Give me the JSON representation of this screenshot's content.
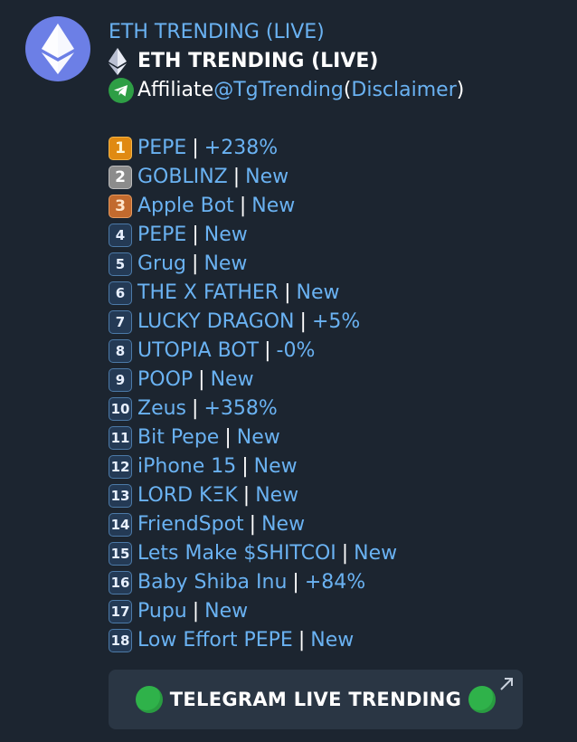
{
  "channel_name": "ETH TRENDING (LIVE)",
  "message": {
    "title": "ETH TRENDING (LIVE)",
    "affiliate": {
      "prefix": "Affiliate ",
      "handle": "@TgTrending",
      "open_paren": " (",
      "disclaimer": "Disclaimer",
      "close_paren": ")"
    },
    "separator": "|",
    "items": [
      {
        "rank": "1",
        "name": "PEPE",
        "change": "+238%"
      },
      {
        "rank": "2",
        "name": "GOBLINZ",
        "change": "New"
      },
      {
        "rank": "3",
        "name": "Apple Bot",
        "change": "New"
      },
      {
        "rank": "4",
        "name": "PEPE",
        "change": "New"
      },
      {
        "rank": "5",
        "name": "Grug",
        "change": "New"
      },
      {
        "rank": "6",
        "name": "THE X FATHER",
        "change": "New"
      },
      {
        "rank": "7",
        "name": "LUCKY DRAGON",
        "change": "+5%"
      },
      {
        "rank": "8",
        "name": "UTOPIA BOT",
        "change": "-0%"
      },
      {
        "rank": "9",
        "name": "POOP",
        "change": "New"
      },
      {
        "rank": "10",
        "name": "Zeus",
        "change": "+358%"
      },
      {
        "rank": "11",
        "name": "Bit Pepe",
        "change": "New"
      },
      {
        "rank": "12",
        "name": "iPhone 15",
        "change": "New"
      },
      {
        "rank": "13",
        "name": "LORD KΞK",
        "change": "New"
      },
      {
        "rank": "14",
        "name": "FriendSpot",
        "change": "New"
      },
      {
        "rank": "15",
        "name": "Lets Make $SHITCOI",
        "change": "New"
      },
      {
        "rank": "16",
        "name": "Baby Shiba Inu",
        "change": "+84%"
      },
      {
        "rank": "17",
        "name": "Pupu",
        "change": "New"
      },
      {
        "rank": "18",
        "name": "Low Effort PEPE",
        "change": "New"
      }
    ]
  },
  "button": {
    "label": "TELEGRAM LIVE TRENDING"
  },
  "colors": {
    "accent": "#6ab2f2",
    "background": "#1c2530",
    "avatar": "#6c7fe6",
    "green_dot": "#2fb24a"
  }
}
